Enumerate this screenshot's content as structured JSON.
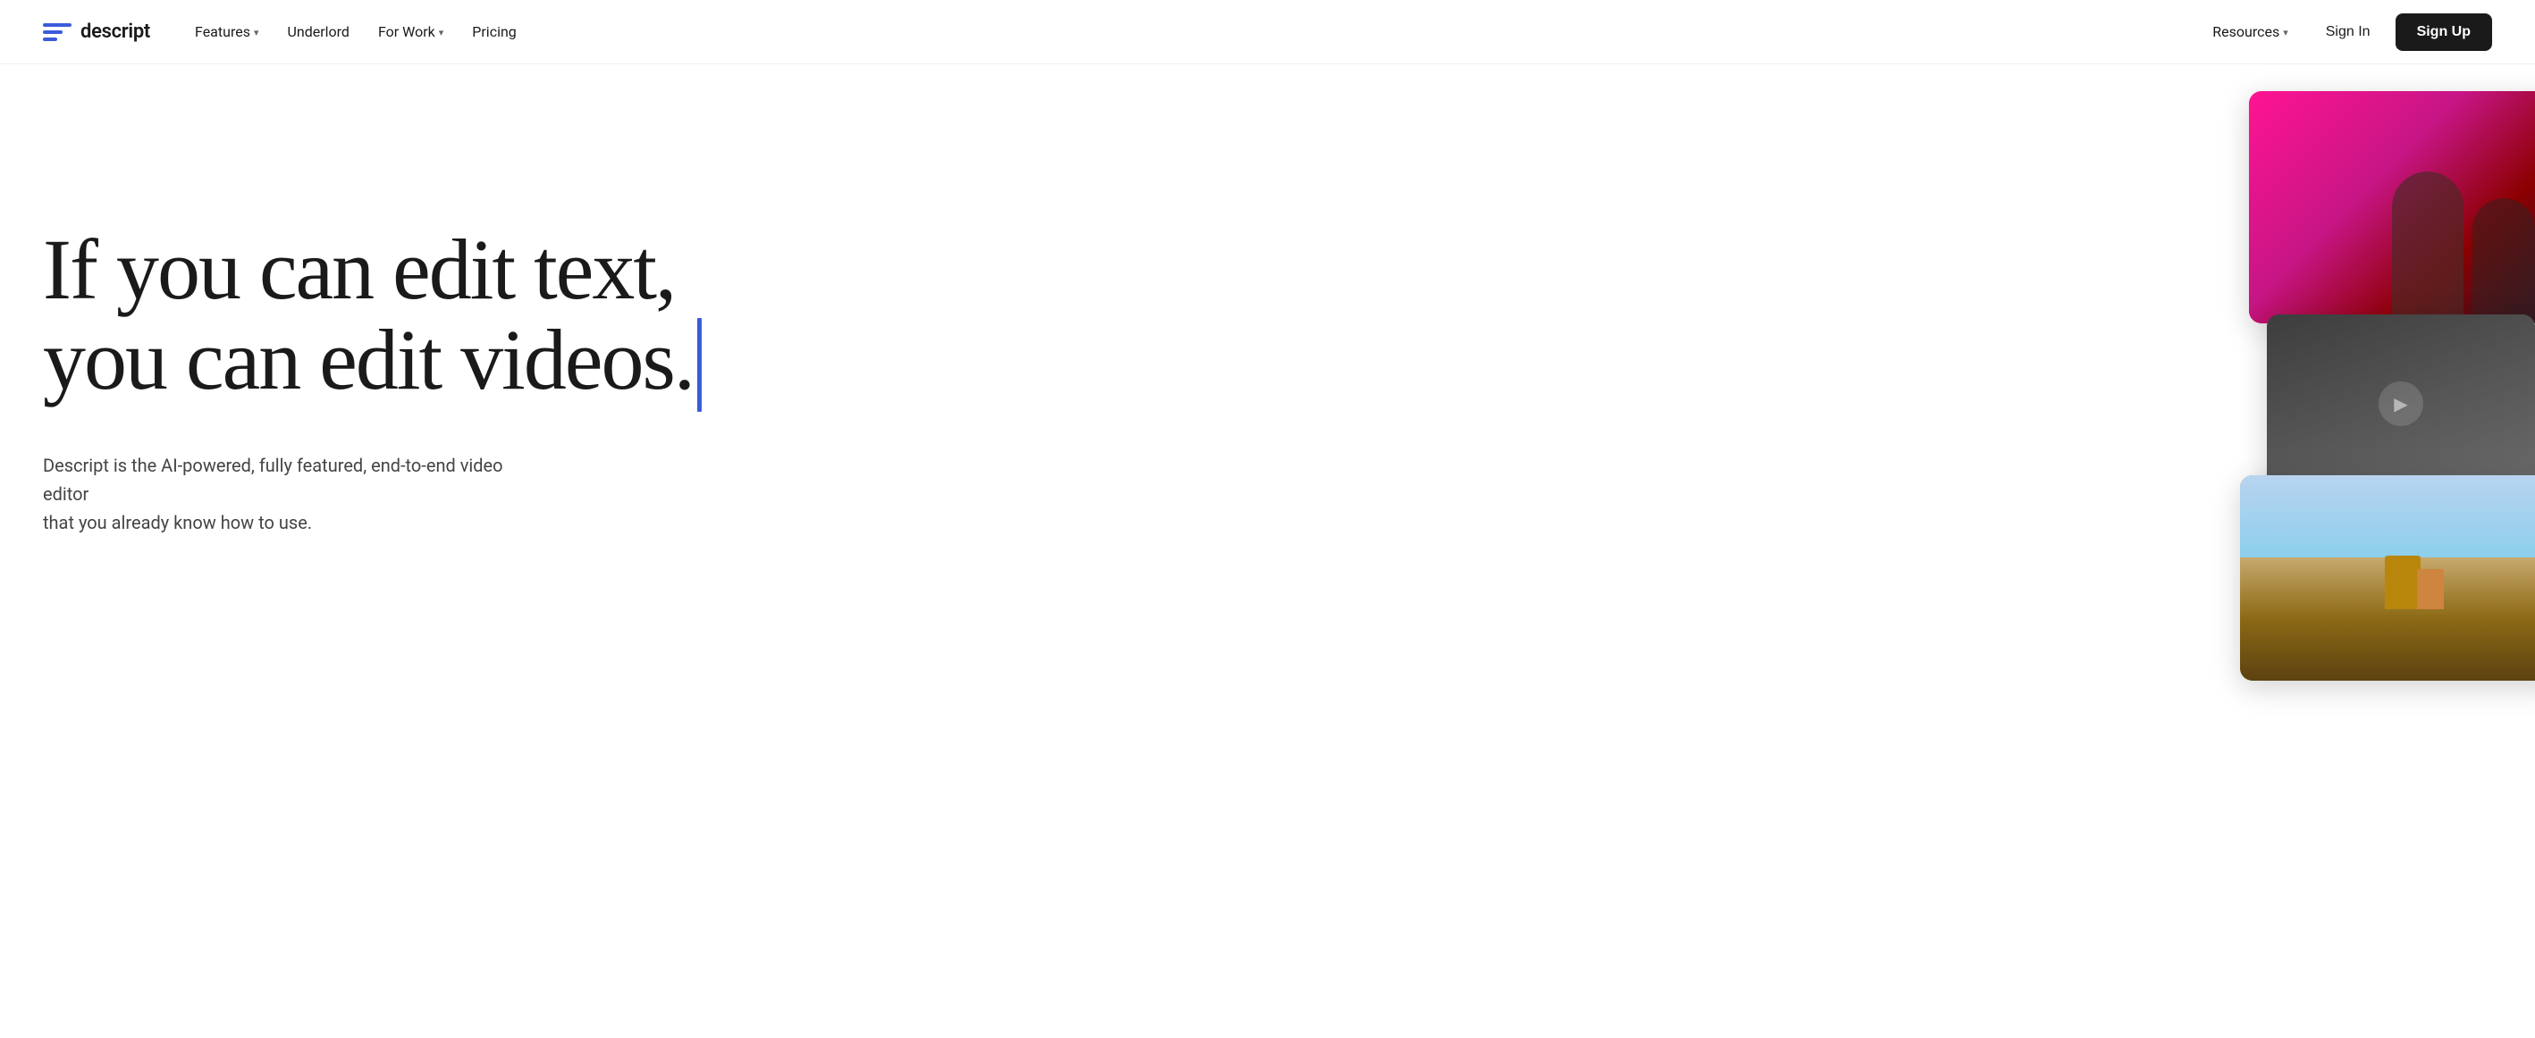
{
  "logo": {
    "text": "descript"
  },
  "nav": {
    "links": [
      {
        "label": "Features",
        "hasDropdown": true
      },
      {
        "label": "Underlord",
        "hasDropdown": false
      },
      {
        "label": "For Work",
        "hasDropdown": true
      },
      {
        "label": "Pricing",
        "hasDropdown": false
      }
    ],
    "right": [
      {
        "label": "Resources",
        "hasDropdown": true
      },
      {
        "label": "Sign In",
        "hasDropdown": false
      }
    ],
    "cta": "Sign Up"
  },
  "hero": {
    "headline_line1": "If you can edit text,",
    "headline_line2": "you can edit videos.",
    "subtext_line1": "Descript is the AI-powered, fully featured, end-to-end video editor",
    "subtext_line2": "that you already know how to use."
  },
  "colors": {
    "cursor": "#3b5bdb",
    "brand": "#1a1a1a",
    "accent": "#3b5bdb"
  }
}
